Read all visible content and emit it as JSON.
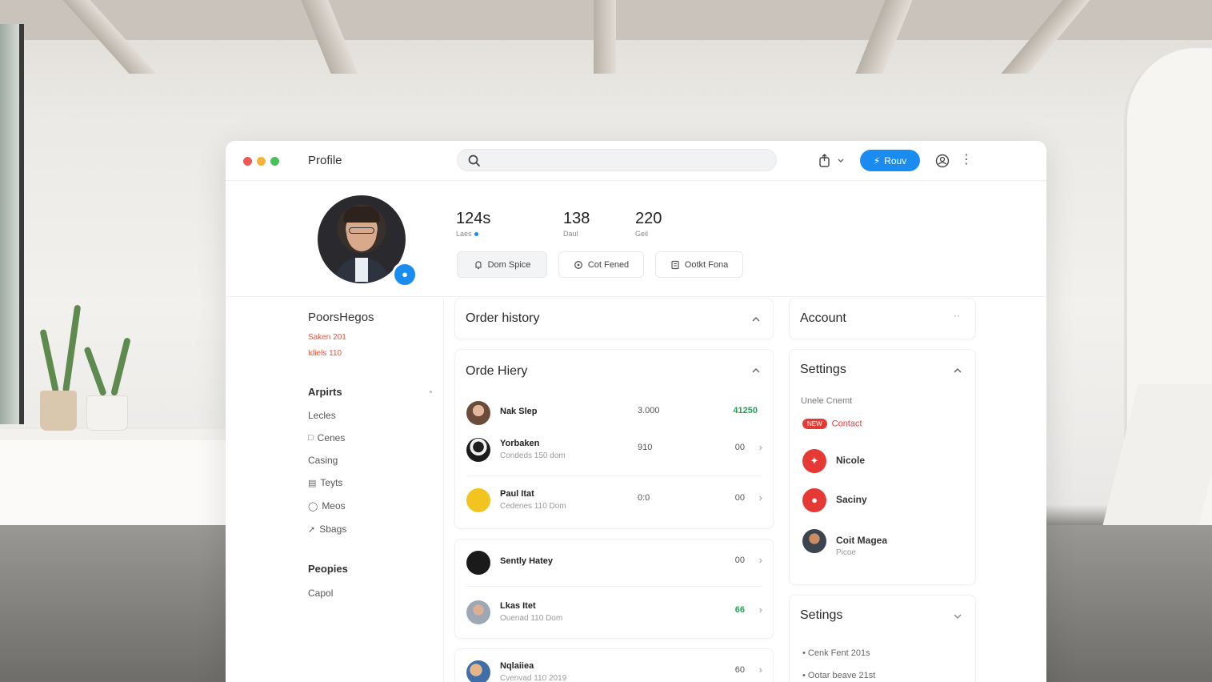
{
  "window": {
    "title": "Profile"
  },
  "search": {
    "placeholder": ""
  },
  "toolbar": {
    "primary_label": "Rouv"
  },
  "profile": {
    "stats": [
      {
        "value": "124s",
        "label": "Laes"
      },
      {
        "value": "138",
        "label": "Daul"
      },
      {
        "value": "220",
        "label": "Geil"
      }
    ],
    "actions": [
      {
        "label": "Dom Spice",
        "icon": "bell-icon"
      },
      {
        "label": "Cot Fened",
        "icon": "circle-icon"
      },
      {
        "label": "Ootkt Fona",
        "icon": "document-icon"
      }
    ]
  },
  "sidebar": {
    "section1": {
      "title": "PoorsHegos",
      "notes": [
        "Saken 201",
        "Idiels 110"
      ]
    },
    "section2": {
      "title": "Arpirts",
      "items": [
        {
          "label": "Lecles",
          "icon": ""
        },
        {
          "label": "Cenes",
          "icon": "square-icon"
        },
        {
          "label": "Casing",
          "icon": ""
        },
        {
          "label": "Teyts",
          "icon": "calendar-icon"
        },
        {
          "label": "Meos",
          "icon": "tag-icon"
        },
        {
          "label": "Sbags",
          "icon": "link-icon"
        }
      ]
    },
    "section3": {
      "title": "Peopies",
      "items": [
        {
          "label": "Capol"
        }
      ]
    }
  },
  "orders": {
    "collapsed_title": "Order history",
    "title": "Orde Hiery",
    "rows": [
      {
        "name": "Nak Slep",
        "sub": "",
        "qty": "3.000",
        "amount": "41250",
        "positive": true
      },
      {
        "name": "Yorbaken",
        "sub": "Condeds 150 dom",
        "qty": "910",
        "amount": "00",
        "positive": false
      },
      {
        "name": "Paul Itat",
        "sub": "Cedenes 110 Dom",
        "qty": "0:0",
        "amount": "00",
        "positive": false
      },
      {
        "name": "Sently Hatey",
        "sub": "",
        "qty": "",
        "amount": "00",
        "positive": false
      },
      {
        "name": "Lkas Itet",
        "sub": "Ouenad 110 Dom",
        "qty": "",
        "amount": "66",
        "positive": true
      },
      {
        "name": "Nqlaiiea",
        "sub": "Cvenvad 110 2019",
        "qty": "",
        "amount": "60",
        "positive": false
      }
    ]
  },
  "account": {
    "title": "Account"
  },
  "settings": {
    "title": "Settings",
    "subtitle": "Unele Cnemt",
    "badge": "NEW",
    "badge_text": "Contact",
    "items": [
      {
        "name": "Nicole",
        "sub": "",
        "color": "#e53935"
      },
      {
        "name": "Saciny",
        "sub": "",
        "color": "#e53935"
      },
      {
        "name": "Coit Magea",
        "sub": "Picoe",
        "color": "#3c4450"
      }
    ]
  },
  "settings2": {
    "title": "Setings",
    "bullets": [
      "Cenk Fent 201s",
      "Ootar beave 21st"
    ]
  },
  "colors": {
    "accent": "#1a8cf0",
    "danger": "#e33a34",
    "positive": "#21a453"
  }
}
